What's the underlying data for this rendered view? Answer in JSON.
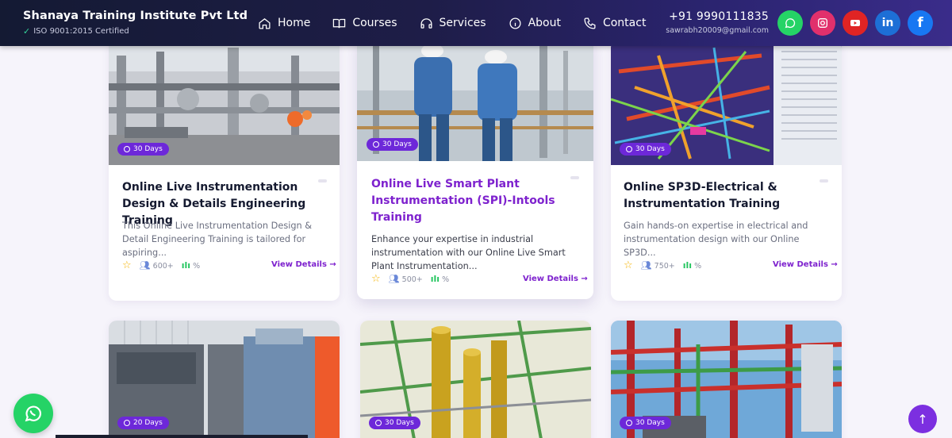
{
  "header": {
    "brand_name": "Shanaya Training Institute Pvt Ltd",
    "certification": "ISO 9001:2015 Certified",
    "nav": [
      {
        "label": "Home",
        "icon": "home-icon"
      },
      {
        "label": "Courses",
        "icon": "book-icon"
      },
      {
        "label": "Services",
        "icon": "headphones-icon"
      },
      {
        "label": "About",
        "icon": "info-icon"
      },
      {
        "label": "Contact",
        "icon": "phone-icon"
      }
    ],
    "phone": "+91 9990111835",
    "email": "sawrabh20009@gmail.com",
    "socials": [
      {
        "name": "whatsapp-icon",
        "color": "#25d366"
      },
      {
        "name": "instagram-icon",
        "color": "#e1306c"
      },
      {
        "name": "youtube-icon",
        "color": "#e02424"
      },
      {
        "name": "linkedin-icon",
        "color": "#1d6fd6"
      },
      {
        "name": "facebook-icon",
        "color": "#1877f2"
      }
    ]
  },
  "courses": [
    {
      "duration": "30 Days",
      "title": "Online Live Instrumentation Design & Details Engineering Training",
      "description": "This Online Live Instrumentation Design & Detail Engineering Training is tailored for aspiring...",
      "students": "600+",
      "percent": "%",
      "view_label": "View Details"
    },
    {
      "duration": "30 Days",
      "title": "Online Live Smart Plant Instrumentation (SPI)-Intools Training",
      "description": "Enhance your expertise in industrial instrumentation with our Online Live Smart Plant Instrumentation...",
      "students": "500+",
      "percent": "%",
      "view_label": "View Details"
    },
    {
      "duration": "30 Days",
      "title": "Online SP3D-Electrical & Instrumentation Training",
      "description": "Gain hands-on expertise in electrical and instrumentation design with our Online SP3D...",
      "students": "750+",
      "percent": "%",
      "view_label": "View Details"
    },
    {
      "duration": "20 Days"
    },
    {
      "duration": "30 Days"
    },
    {
      "duration": "30 Days"
    }
  ],
  "colors": {
    "accent": "#7e22ce",
    "badge": "#6d28d9",
    "whatsapp": "#25d366"
  }
}
